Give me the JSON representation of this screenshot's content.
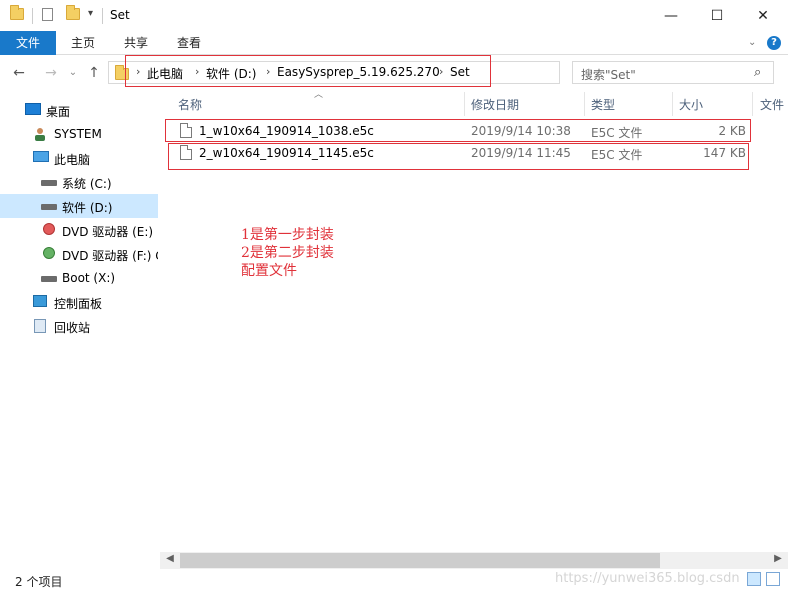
{
  "window": {
    "title": "Set",
    "minimize_glyph": "—",
    "maximize_glyph": "☐",
    "close_glyph": "✕"
  },
  "ribbon": {
    "tabs": [
      "文件",
      "主页",
      "共享",
      "查看"
    ],
    "expand_glyph": "⌄",
    "help_glyph": "?"
  },
  "nav": {
    "back_glyph": "←",
    "forward_glyph": "→",
    "recent_glyph": "⌄",
    "up_glyph": "↑",
    "breadcrumb": [
      "此电脑",
      "软件 (D:)",
      "EasySysprep_5.19.625.270",
      "Set"
    ],
    "crumb_separator": "›",
    "refresh_glyph": "⟳",
    "dropdown_glyph": "⌄"
  },
  "search": {
    "placeholder": "搜索\"Set\"",
    "icon_glyph": "⌕"
  },
  "sidebar": {
    "items": [
      {
        "label": "桌面",
        "icon": "desktop-icon"
      },
      {
        "label": "SYSTEM",
        "icon": "user-folder-icon"
      },
      {
        "label": "此电脑",
        "icon": "this-pc-icon"
      },
      {
        "label": "系统 (C:)",
        "icon": "drive-icon"
      },
      {
        "label": "软件 (D:)",
        "icon": "drive-icon",
        "selected": true
      },
      {
        "label": "DVD 驱动器 (E:) E",
        "icon": "dvd-icon"
      },
      {
        "label": "DVD 驱动器 (F:) C",
        "icon": "dvd-icon"
      },
      {
        "label": "Boot (X:)",
        "icon": "drive-icon"
      },
      {
        "label": "控制面板",
        "icon": "control-panel-icon"
      },
      {
        "label": "回收站",
        "icon": "recycle-bin-icon"
      }
    ]
  },
  "columns": {
    "name": "名称",
    "modified": "修改日期",
    "type": "类型",
    "size": "大小",
    "extra": "文件"
  },
  "files": [
    {
      "name": "1_w10x64_190914_1038.e5c",
      "modified": "2019/9/14 10:38",
      "type": "E5C 文件",
      "size": "2 KB"
    },
    {
      "name": "2_w10x64_190914_1145.e5c",
      "modified": "2019/9/14 11:45",
      "type": "E5C 文件",
      "size": "147 KB"
    }
  ],
  "annotation": {
    "lines": [
      "1是第一步封装",
      "2是第二步封装",
      "配置文件"
    ],
    "color": "#e0323a"
  },
  "status": {
    "item_count": "2 个项目",
    "watermark": "https://yunwei365.blog.csdn"
  },
  "colors": {
    "accent": "#1979ca",
    "selection": "#cce8ff",
    "annotation_red": "#e0323a"
  }
}
